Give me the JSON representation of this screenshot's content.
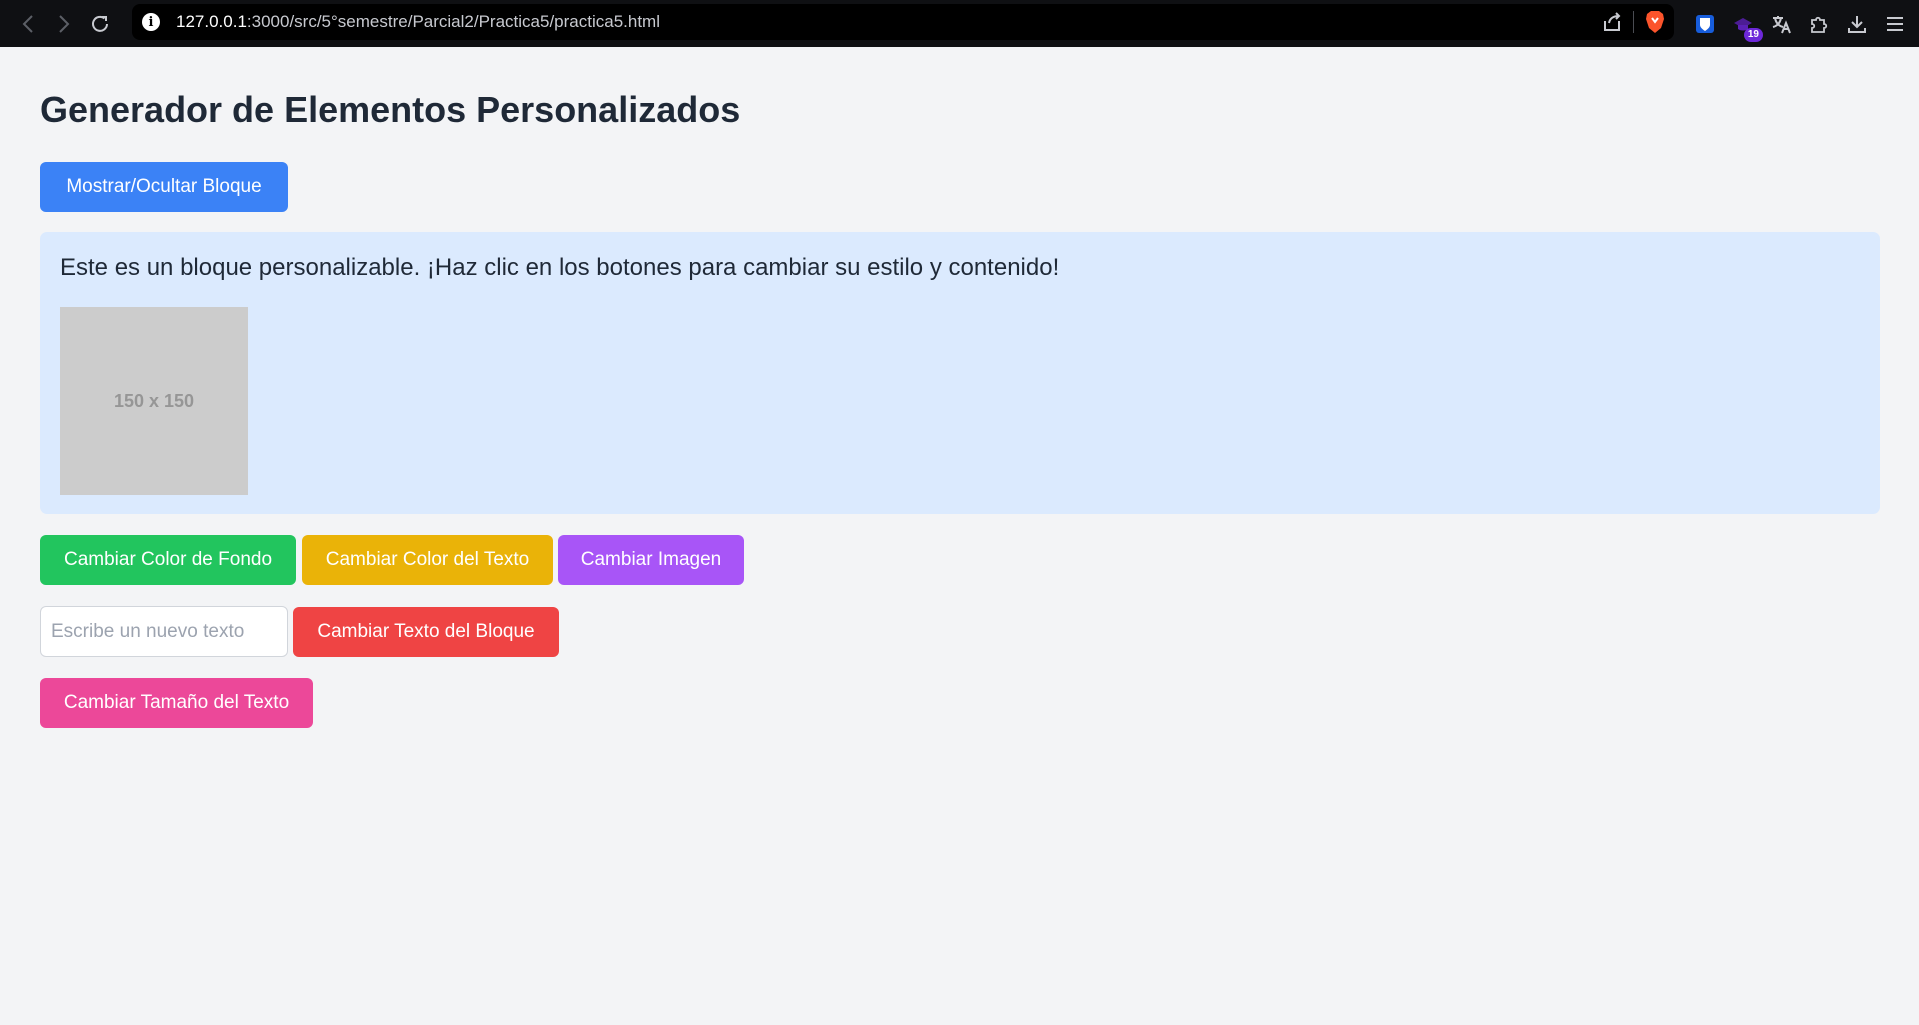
{
  "browser": {
    "url_host": "127.0.0.1",
    "url_path": ":3000/src/5°semestre/Parcial2/Practica5/practica5.html",
    "extension_badge": "19"
  },
  "page": {
    "title": "Generador de Elementos Personalizados",
    "toggle_button": "Mostrar/Ocultar Bloque",
    "block_text": "Este es un bloque personalizable. ¡Haz clic en los botones para cambiar su estilo y contenido!",
    "image_label": "150 x 150",
    "bg_color_button": "Cambiar Color de Fondo",
    "text_color_button": "Cambiar Color del Texto",
    "image_button": "Cambiar Imagen",
    "text_input_placeholder": "Escribe un nuevo texto",
    "text_input_value": "",
    "change_text_button": "Cambiar Texto del Bloque",
    "text_size_button": "Cambiar Tamaño del Texto"
  },
  "colors": {
    "toggle_button": "#3b82f6",
    "block_background": "#dbeafe",
    "bg_color_button": "#22c55e",
    "text_color_button": "#eab308",
    "image_button": "#a855f7",
    "change_text_button": "#ef4444",
    "text_size_button": "#ec4899"
  }
}
